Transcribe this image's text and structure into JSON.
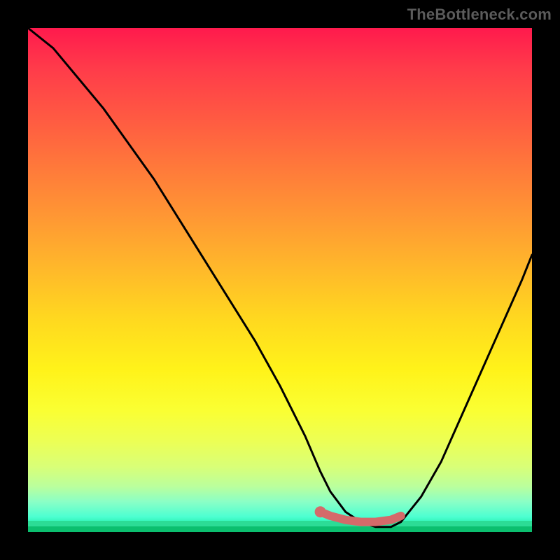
{
  "watermark": {
    "text": "TheBottleneck.com"
  },
  "colors": {
    "curve": "#000000",
    "accent": "#d46a6a",
    "accent_dot": "#d46a6a"
  },
  "chart_data": {
    "type": "line",
    "title": "",
    "xlabel": "",
    "ylabel": "",
    "xlim": [
      0,
      100
    ],
    "ylim": [
      0,
      100
    ],
    "series": [
      {
        "name": "bottleneck-curve",
        "x": [
          0,
          5,
          10,
          15,
          20,
          25,
          30,
          35,
          40,
          45,
          50,
          55,
          58,
          60,
          63,
          66,
          69,
          72,
          74,
          78,
          82,
          86,
          90,
          94,
          98,
          100
        ],
        "values": [
          100,
          96,
          90,
          84,
          77,
          70,
          62,
          54,
          46,
          38,
          29,
          19,
          12,
          8,
          4,
          2,
          1,
          1,
          2,
          7,
          14,
          23,
          32,
          41,
          50,
          55
        ]
      }
    ],
    "highlight_segment": {
      "x": [
        58,
        60,
        63,
        66,
        69,
        72,
        74
      ],
      "values": [
        4,
        3.2,
        2.4,
        2.0,
        2.0,
        2.4,
        3.2
      ]
    },
    "highlight_dot": {
      "x": 58,
      "value": 4
    }
  }
}
